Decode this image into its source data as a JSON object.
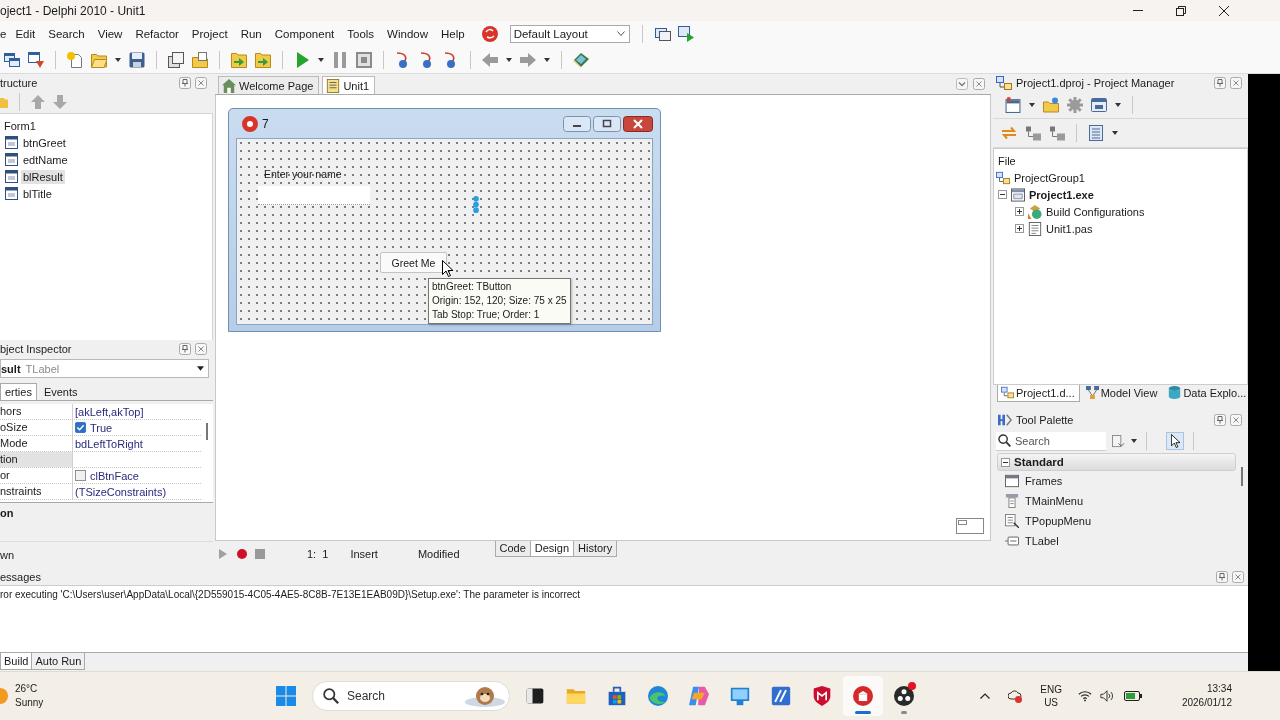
{
  "window": {
    "title": "oject1 - Delphi 2010 - Unit1"
  },
  "menu": [
    "e",
    "Edit",
    "Search",
    "View",
    "Refactor",
    "Project",
    "Run",
    "Component",
    "Tools",
    "Window",
    "Help"
  ],
  "layout": {
    "value": "Default Layout"
  },
  "structure": {
    "title": "tructure",
    "tree": [
      {
        "label": "Form1",
        "selected": false,
        "children": [
          {
            "label": "btnGreet",
            "selected": false
          },
          {
            "label": "edtName",
            "selected": false
          },
          {
            "label": "blResult",
            "selected": true
          },
          {
            "label": "blTitle",
            "selected": false
          }
        ]
      }
    ]
  },
  "object_inspector": {
    "title": "bject Inspector",
    "object_name": "sult",
    "object_type": "TLabel",
    "tabs": [
      {
        "label": "erties",
        "selected": true
      },
      {
        "label": "Events",
        "selected": false
      }
    ],
    "properties": [
      {
        "kind": "text",
        "name": "hors",
        "value": "[akLeft,akTop]",
        "selected": false
      },
      {
        "kind": "checkbox",
        "name": "oSize",
        "value": "True",
        "checked": true,
        "selected": false
      },
      {
        "kind": "text",
        "name": "Mode",
        "value": "bdLeftToRight",
        "selected": false
      },
      {
        "kind": "text",
        "name": "tion",
        "selected": true
      },
      {
        "kind": "color",
        "name": "or",
        "value": "clBtnFace",
        "selected": false
      },
      {
        "kind": "text",
        "name": "nstraints",
        "value": "(TSizeConstraints)",
        "selected": false
      }
    ],
    "description": "on",
    "status": "wn"
  },
  "editor": {
    "tabs": [
      {
        "kind": "home",
        "label": "Welcome Page",
        "selected": false
      },
      {
        "kind": "unit",
        "label": "Unit1",
        "selected": true
      }
    ],
    "form": {
      "title": "7",
      "label": "Enter your name",
      "button": "Greet Me",
      "tooltip": [
        "btnGreet: TButton",
        "Origin: 152, 120; Size: 75 x 25",
        "Tab Stop: True; Order: 1"
      ]
    },
    "status": {
      "position": "1:  1",
      "mode": "Insert",
      "state": "Modified"
    },
    "view_tabs": [
      {
        "label": "Code",
        "selected": false
      },
      {
        "label": "Design",
        "selected": true
      },
      {
        "label": "History",
        "selected": false
      }
    ]
  },
  "project_manager": {
    "title": "Project1.dproj - Project Manager",
    "column": "File",
    "tree": [
      {
        "kind": "group",
        "label": "ProjectGroup1",
        "children": [
          {
            "kind": "project",
            "label": "Project1.exe",
            "expanded": true,
            "children": [
              {
                "kind": "config",
                "label": "Build Configurations",
                "expanded": false
              },
              {
                "kind": "unit",
                "label": "Unit1.pas",
                "expanded": false
              }
            ]
          }
        ]
      }
    ],
    "tabs": [
      {
        "kind": "project",
        "label": "Project1.d...",
        "selected": true
      },
      {
        "kind": "model",
        "label": "Model View",
        "selected": false
      },
      {
        "kind": "data",
        "label": "Data Explo...",
        "selected": false
      }
    ]
  },
  "tool_palette": {
    "title": "Tool Palette",
    "search": {
      "placeholder": "Search"
    },
    "pointer_tool": {
      "selected": true
    },
    "category": {
      "label": "Standard",
      "expanded": true
    },
    "items": [
      {
        "kind": "frame",
        "label": "Frames"
      },
      {
        "kind": "mainmenu",
        "label": "TMainMenu"
      },
      {
        "kind": "popupmenu",
        "label": "TPopupMenu"
      },
      {
        "kind": "label",
        "label": "TLabel"
      }
    ]
  },
  "messages": {
    "title": "essages",
    "lines": [
      "ror executing 'C:\\Users\\user\\AppData\\Local\\{2D559015-4C05-4AE5-8C8B-7E13E1EAB09D}\\Setup.exe': The parameter is incorrect"
    ],
    "tabs": [
      {
        "label": "Build",
        "selected": true
      },
      {
        "label": "Auto Run",
        "selected": false
      }
    ]
  },
  "taskbar": {
    "weather": {
      "temperature": "26°C",
      "condition": "Sunny"
    },
    "search": {
      "placeholder": "Search"
    },
    "apps": [
      {
        "kind": "taskview",
        "active": false,
        "running": false,
        "badge": false
      },
      {
        "kind": "explorer",
        "active": false,
        "running": false,
        "badge": false
      },
      {
        "kind": "store",
        "active": false,
        "running": false,
        "badge": false
      },
      {
        "kind": "browser",
        "active": false,
        "running": false,
        "badge": false
      },
      {
        "kind": "assistant",
        "active": false,
        "running": false,
        "badge": false
      },
      {
        "kind": "monitor",
        "active": false,
        "running": false,
        "badge": false
      },
      {
        "kind": "tile",
        "active": false,
        "running": false,
        "badge": false
      },
      {
        "kind": "shield",
        "active": false,
        "running": false,
        "badge": false
      },
      {
        "kind": "ide",
        "active": true,
        "running": true,
        "badge": false
      },
      {
        "kind": "recorder",
        "active": false,
        "running": true,
        "badge": true
      }
    ],
    "tray": {
      "language": "ENG",
      "region": "US",
      "time": "13:34",
      "date": "2026/01/12"
    }
  }
}
